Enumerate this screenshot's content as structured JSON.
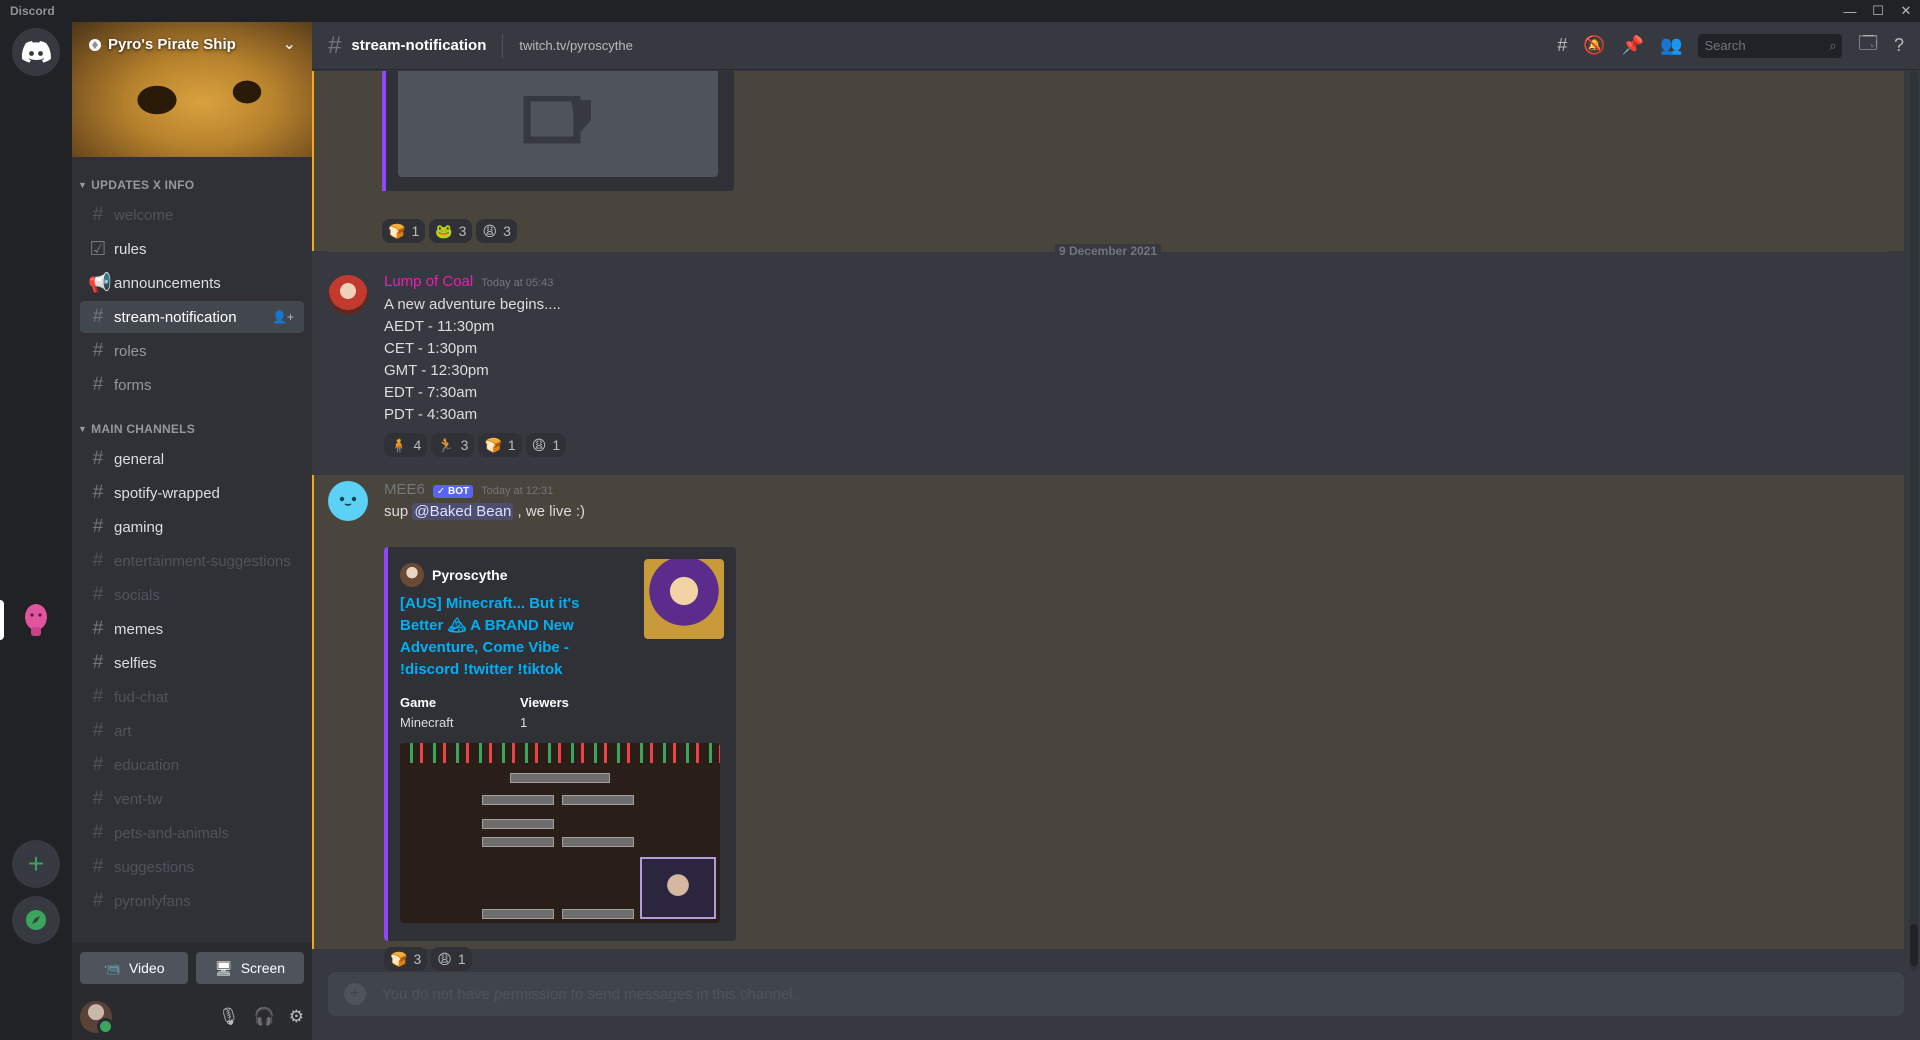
{
  "window": {
    "app_name": "Discord",
    "minimize": "—",
    "maximize": "☐",
    "close": "✕"
  },
  "server": {
    "name": "Pyro's Pirate Ship"
  },
  "categories": [
    {
      "label": "UPDATES X INFO"
    },
    {
      "label": "MAIN CHANNELS"
    }
  ],
  "channels_updates": [
    {
      "label": "welcome",
      "icon": "hash-icon"
    },
    {
      "label": "rules",
      "icon": "checkbox-icon"
    },
    {
      "label": "announcements",
      "icon": "megaphone-icon"
    },
    {
      "label": "stream-notification",
      "icon": "hash-icon"
    },
    {
      "label": "roles",
      "icon": "hash-icon"
    },
    {
      "label": "forms",
      "icon": "hash-icon"
    }
  ],
  "channels_main": [
    {
      "label": "general"
    },
    {
      "label": "spotify-wrapped"
    },
    {
      "label": "gaming"
    },
    {
      "label": "entertainment-suggestions"
    },
    {
      "label": "socials"
    },
    {
      "label": "memes"
    },
    {
      "label": "selfies"
    },
    {
      "label": "fud-chat"
    },
    {
      "label": "art"
    },
    {
      "label": "education"
    },
    {
      "label": "vent-tw"
    },
    {
      "label": "pets-and-animals"
    },
    {
      "label": "suggestions"
    },
    {
      "label": "pyronlyfans"
    }
  ],
  "voice": {
    "video": "Video",
    "screen": "Screen"
  },
  "header": {
    "channel": "stream-notification",
    "topic": "twitch.tv/pyroscythe",
    "search_placeholder": "Search"
  },
  "reactions_top": [
    {
      "emoji": "🍞",
      "count": "1"
    },
    {
      "emoji": "🐸",
      "count": "3"
    },
    {
      "emoji": "😩",
      "count": "3"
    }
  ],
  "date_divider": "9 December 2021",
  "message1": {
    "author": "Lump of Coal",
    "author_color": "#e91eb0",
    "time": "Today at 05:43",
    "lines": [
      "A new adventure begins....",
      "AEDT - 11:30pm",
      "CET - 1:30pm",
      "GMT - 12:30pm",
      "EDT - 7:30am",
      "PDT - 4:30am"
    ],
    "reactions": [
      {
        "emoji": "🧍",
        "count": "4"
      },
      {
        "emoji": "🏃",
        "count": "3"
      },
      {
        "emoji": "🍞",
        "count": "1"
      },
      {
        "emoji": "😩",
        "count": "1"
      }
    ]
  },
  "message2": {
    "author": "MEE6",
    "bot_tag": "✓ BOT",
    "time": "Today at 12:31",
    "text_pre": "sup ",
    "mention": "@Baked Bean",
    "text_post": " , we live :)",
    "embed": {
      "author": "Pyroscythe",
      "title": "[AUS] Minecraft... But it's Better 🏔 A BRAND New Adventure, Come Vibe - !discord !twitter !tiktok",
      "field1_name": "Game",
      "field1_value": "Minecraft",
      "field2_name": "Viewers",
      "field2_value": "1"
    },
    "reactions": [
      {
        "emoji": "🍞",
        "count": "3"
      },
      {
        "emoji": "😩",
        "count": "1"
      }
    ]
  },
  "composer": {
    "placeholder": "You do not have permission to send messages in this channel."
  }
}
